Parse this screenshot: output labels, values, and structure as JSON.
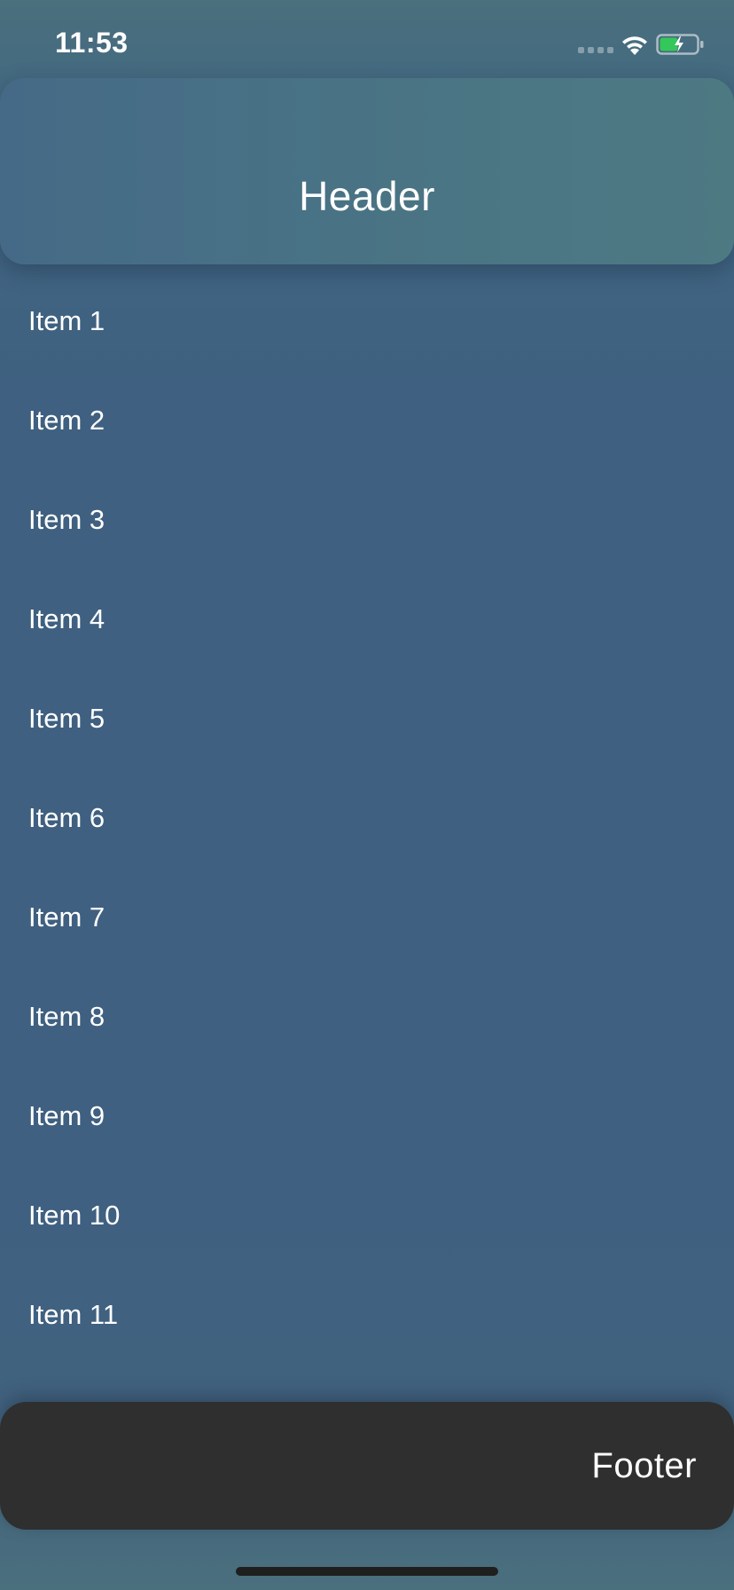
{
  "status_bar": {
    "time": "11:53",
    "signal_icon": "cellular-signal-icon",
    "wifi_icon": "wifi-icon",
    "battery_icon": "battery-charging-icon",
    "battery_level": 0.5,
    "battery_color": "#34c759"
  },
  "header": {
    "title": "Header"
  },
  "list": {
    "items": [
      {
        "label": "Item 1"
      },
      {
        "label": "Item 2"
      },
      {
        "label": "Item 3"
      },
      {
        "label": "Item 4"
      },
      {
        "label": "Item 5"
      },
      {
        "label": "Item 6"
      },
      {
        "label": "Item 7"
      },
      {
        "label": "Item 8"
      },
      {
        "label": "Item 9"
      },
      {
        "label": "Item 10"
      },
      {
        "label": "Item 11"
      }
    ]
  },
  "footer": {
    "title": "Footer"
  },
  "colors": {
    "background": "#3f6080",
    "header_background": "#4a7584",
    "footer_background": "#2f2f2f",
    "text": "#ffffff"
  }
}
